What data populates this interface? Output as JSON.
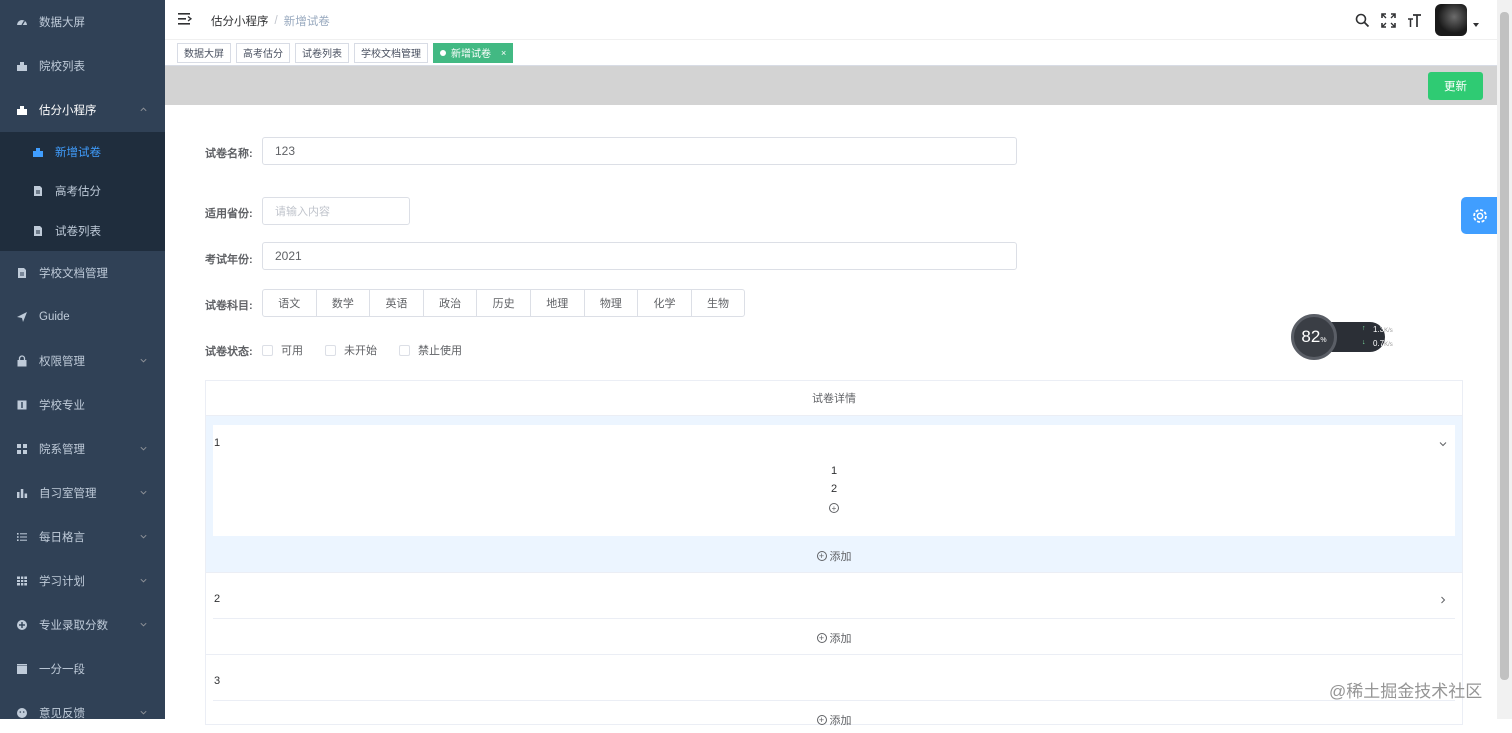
{
  "sidebar": {
    "items": [
      {
        "label": "数据大屏",
        "icon": "dashboard-icon"
      },
      {
        "label": "院校列表",
        "icon": "school-icon"
      },
      {
        "label": "估分小程序",
        "icon": "school-icon"
      },
      {
        "label": "学校文档管理",
        "icon": "document-icon"
      },
      {
        "label": "Guide",
        "icon": "send-icon"
      },
      {
        "label": "权限管理",
        "icon": "lock-icon"
      },
      {
        "label": "学校专业",
        "icon": "info-icon"
      },
      {
        "label": "院系管理",
        "icon": "grid-icon"
      },
      {
        "label": "自习室管理",
        "icon": "chart-icon"
      },
      {
        "label": "每日格言",
        "icon": "list-icon"
      },
      {
        "label": "学习计划",
        "icon": "table-icon"
      },
      {
        "label": "专业录取分数",
        "icon": "plus-circle-icon"
      },
      {
        "label": "一分一段",
        "icon": "clapper-icon"
      },
      {
        "label": "意见反馈",
        "icon": "feedback-icon"
      }
    ],
    "submenu": [
      {
        "label": "新增试卷"
      },
      {
        "label": "高考估分"
      },
      {
        "label": "试卷列表"
      }
    ]
  },
  "breadcrumb": {
    "parent": "估分小程序",
    "separator": "/",
    "current": "新增试卷"
  },
  "tags": [
    "数据大屏",
    "高考估分",
    "试卷列表",
    "学校文档管理"
  ],
  "active_tag": {
    "label": "新增试卷",
    "close": "×"
  },
  "toolbar": {
    "update_label": "更新"
  },
  "form": {
    "name_label": "试卷名称:",
    "name_value": "123",
    "province_label": "适用省份:",
    "province_placeholder": "请输入内容",
    "year_label": "考试年份:",
    "year_value": "2021",
    "subject_label": "试卷科目:",
    "subjects": [
      "语文",
      "数学",
      "英语",
      "政治",
      "历史",
      "地理",
      "物理",
      "化学",
      "生物"
    ],
    "status_label": "试卷状态:",
    "statuses": [
      "可用",
      "未开始",
      "禁止使用"
    ]
  },
  "detail": {
    "title": "试卷详情",
    "sections": [
      {
        "num": "1",
        "items": [
          "1",
          "2"
        ],
        "add": "添加"
      },
      {
        "num": "2",
        "add": "添加"
      },
      {
        "num": "3",
        "add": "添加"
      }
    ]
  },
  "speed_widget": {
    "percent": "82",
    "percent_unit": "%",
    "up": "1.3",
    "down": "0.7",
    "unit": "K/s"
  },
  "watermark": "@稀土掘金技术社区",
  "colors": {
    "sidebar_bg": "#304156",
    "submenu_bg": "#1f2d3d",
    "accent": "#409eff",
    "tag_active": "#42b983",
    "update_button": "#2fcb73"
  }
}
